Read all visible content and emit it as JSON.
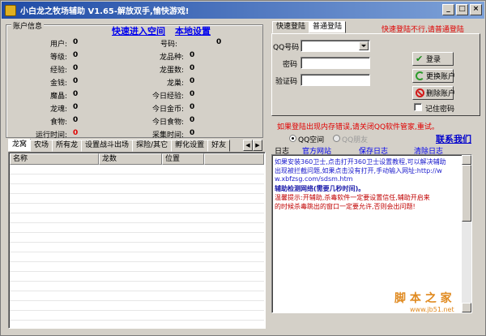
{
  "window": {
    "title": "小白龙之牧场辅助 V1.65-解放双手,愉快游戏!",
    "buttons": [
      "_",
      "□",
      "×"
    ]
  },
  "account": {
    "group_title": "账户信息",
    "quick_enter": "快速进入空间",
    "local_settings": "本地设置",
    "fields": [
      {
        "label": "用户:",
        "value": "0"
      },
      {
        "label": "号码:",
        "value": "0"
      },
      {
        "label": "等级:",
        "value": "0"
      },
      {
        "label": "龙品种:",
        "value": "0"
      },
      {
        "label": "经验:",
        "value": "0"
      },
      {
        "label": "龙蛋数:",
        "value": "0"
      },
      {
        "label": "金钱:",
        "value": "0"
      },
      {
        "label": "龙巢:",
        "value": "0"
      },
      {
        "label": "魔晶:",
        "value": "0"
      },
      {
        "label": "今日经验:",
        "value": "0"
      },
      {
        "label": "龙魂:",
        "value": "0"
      },
      {
        "label": "今日金币:",
        "value": "0"
      },
      {
        "label": "食物:",
        "value": "0"
      },
      {
        "label": "今日食物:",
        "value": "0"
      },
      {
        "label": "运行时间:",
        "value": "0"
      },
      {
        "label": "采集时间:",
        "value": "0"
      }
    ]
  },
  "tabs": [
    "龙窝",
    "农场",
    "所有龙",
    "设置战斗出场",
    "探险/其它",
    "孵化设置",
    "好友"
  ],
  "listview": {
    "columns": [
      "名称",
      "龙数",
      "位置"
    ]
  },
  "login": {
    "tabs": [
      "快速登陆",
      "普通登陆"
    ],
    "fast_warning": "快速登陆不行,请普通登陆",
    "qq_label": "QQ号码",
    "password_label": "密码",
    "captcha_label": "验证码",
    "login_button": "登录",
    "switch_button": "更换账户",
    "delete_button": "删除账户",
    "remember_label": "记住密码",
    "note": "如果登陆出现内存错误,请关闭QQ软件管家,重试。"
  },
  "radios": {
    "qq_space": "QQ空间",
    "qq_friends": "QQ朋友"
  },
  "contact": "联系我们",
  "log": {
    "label": "日志",
    "links": [
      "官方网站",
      "保存日志",
      "清除日志"
    ],
    "lines": [
      "如果安装360卫士,点击打开360卫士设置教程,可以解决辅助",
      "出现被拦截问题,如果点击没有打开,手动输入网址:http://w",
      "w.xbfzsg.com/sdsm.htm",
      "辅助检测网络(需要几秒时间)。",
      "温馨提示:开辅助,杀毒软件一定要设置信任,辅助开启来",
      "的时候杀毒跳出的窗口一定要允许,否则会出问题!"
    ]
  },
  "watermark": {
    "brand": "脚 本 之 家",
    "url": "www.jb51.net"
  }
}
